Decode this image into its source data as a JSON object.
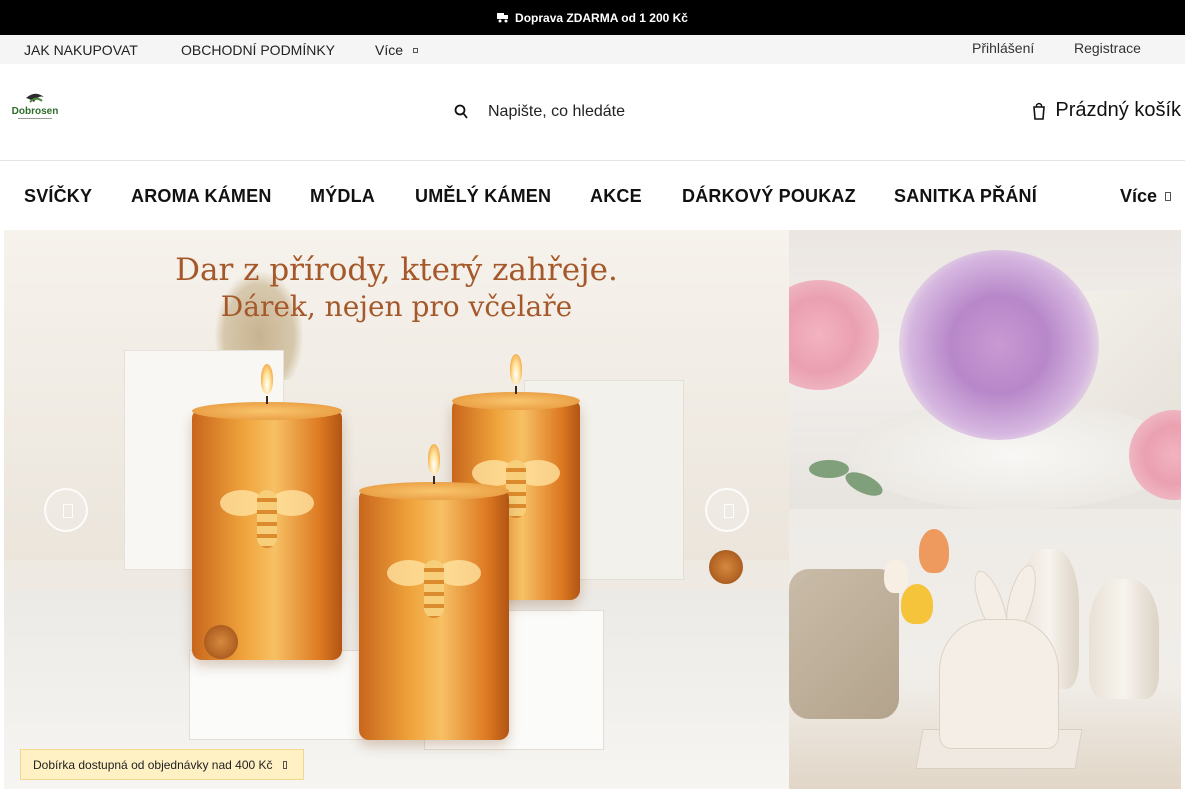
{
  "promo": {
    "text": "Doprava ZDARMA od 1 200 Kč",
    "icon": "truck-icon"
  },
  "util_nav": {
    "items": [
      "JAK NAKUPOVAT",
      "OBCHODNÍ PODMÍNKY",
      "Více"
    ],
    "login": "Přihlášení",
    "register": "Registrace"
  },
  "header": {
    "logo_text": "Dobrosen",
    "search_placeholder": "Napište, co hledáte",
    "cart_label": "Prázdný košík",
    "search_icon": "search-icon",
    "cart_icon": "cart-icon"
  },
  "menu": {
    "items": [
      "SVÍČKY",
      "AROMA KÁMEN",
      "MÝDLA",
      "UMĚLÝ KÁMEN",
      "AKCE",
      "DÁRKOVÝ POUKAZ",
      "SANITKA PŘÁNÍ"
    ],
    "more": "Více"
  },
  "hero": {
    "headline": "Dar z přírody, který zahřeje.",
    "subline": "Dárek, nejen pro včelaře"
  },
  "cod_notice": {
    "text": "Dobírka dostupná od objednávky nad 400 Kč"
  },
  "colors": {
    "promo_bg": "#000000",
    "hero_text": "#a5582a",
    "notice_bg": "#fff1c4"
  }
}
